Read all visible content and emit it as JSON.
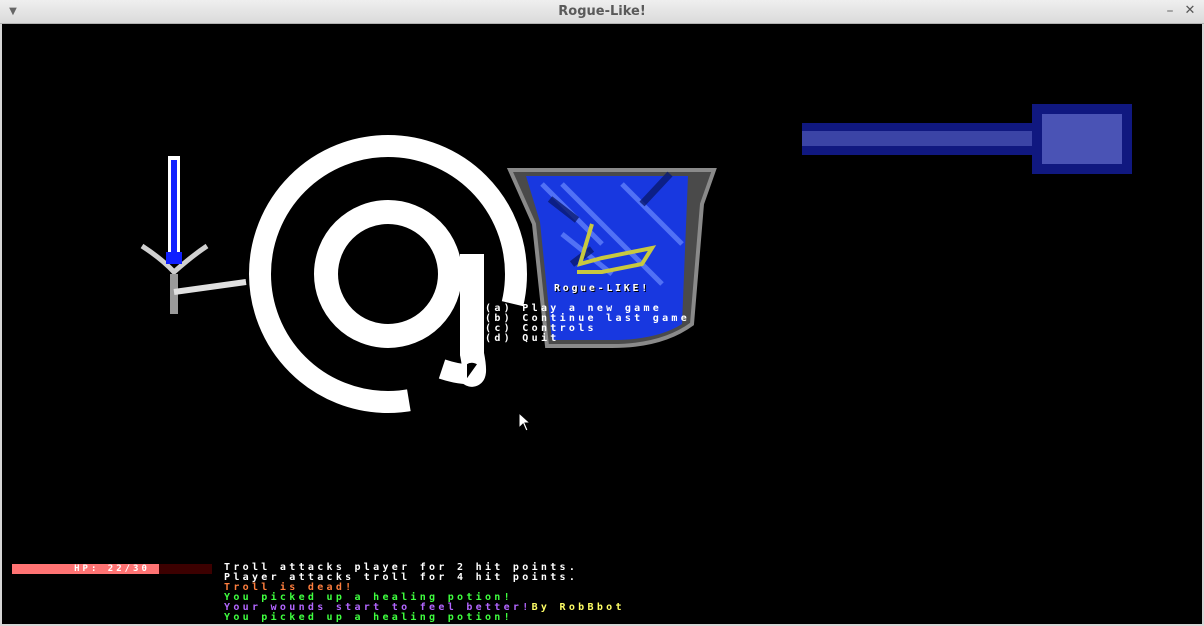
{
  "window": {
    "title": "Rogue-Like!",
    "menu_icon": "chevron-down-icon",
    "minimize_icon": "minimize-icon",
    "close_icon": "close-icon"
  },
  "logo": {
    "title": "Rogue-LIKE!"
  },
  "menu": {
    "items": [
      {
        "key": "(a)",
        "label": "Play a new game"
      },
      {
        "key": "(b)",
        "label": "Continue last game"
      },
      {
        "key": "(c)",
        "label": "Controls"
      },
      {
        "key": "(d)",
        "label": "Quit"
      }
    ]
  },
  "hud": {
    "hp_label": "HP: 22/30",
    "hp_current": 22,
    "hp_max": 30,
    "hp_color": "#ff7373",
    "hp_back_color": "#3c0000"
  },
  "log": [
    {
      "text": "Troll attacks player for 2 hit points.",
      "color": "#ffffff"
    },
    {
      "text": "Player attacks troll for 4 hit points.",
      "color": "#ffffff"
    },
    {
      "text": "Troll is dead!",
      "color": "#ff7f3f"
    },
    {
      "text": "You picked up a healing potion!",
      "color": "#3fff3f"
    },
    {
      "text": "Your wounds start to feel better!",
      "color": "#b366ff",
      "suffix": "By RobBbot",
      "suffix_color": "#ffff66"
    },
    {
      "text": "You picked up a healing potion!",
      "color": "#3fff3f"
    }
  ]
}
